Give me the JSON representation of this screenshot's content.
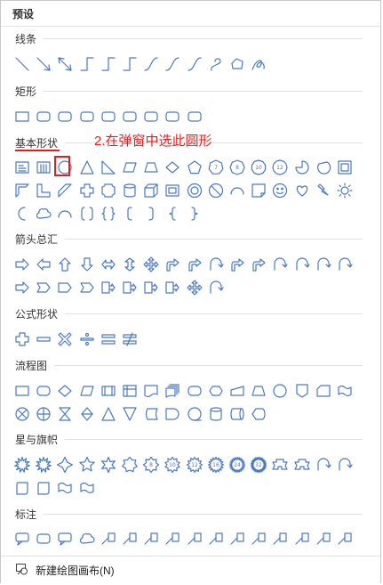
{
  "panel": {
    "title": "预设"
  },
  "sections": [
    {
      "label": "线条",
      "icons": [
        "line-icon",
        "arrow-line-icon",
        "double-arrow-line-icon",
        "elbow-connector-icon",
        "elbow-arrow-connector-icon",
        "elbow-double-arrow-connector-icon",
        "curved-connector-icon",
        "curved-arrow-connector-icon",
        "curved-double-arrow-connector-icon",
        "curve-icon",
        "freeform-icon",
        "scribble-icon"
      ]
    },
    {
      "label": "矩形",
      "icons": [
        "rectangle-icon",
        "rounded-rectangle-icon",
        "snip-single-corner-rectangle-icon",
        "snip-same-side-rectangle-icon",
        "snip-diagonal-rectangle-icon",
        "snip-round-rectangle-icon",
        "round-single-corner-rectangle-icon",
        "round-same-side-rectangle-icon",
        "round-diagonal-rectangle-icon"
      ]
    },
    {
      "label": "基本形状",
      "icons": [
        "text-box-icon",
        "vertical-text-box-icon",
        "oval-icon",
        "triangle-icon",
        "right-triangle-icon",
        "parallelogram-icon",
        "trapezoid-icon",
        "diamond-icon",
        "pentagon-icon",
        "heptagon-icon",
        "octagon-icon",
        "decagon-icon",
        "dodecagon-icon",
        "pie-icon",
        "chord-icon",
        "frame-icon",
        "half-frame-icon",
        "l-shape-icon",
        "diagonal-stripe-icon",
        "cross-icon",
        "plaque-icon",
        "can-icon",
        "cube-icon",
        "bevel-icon",
        "donut-icon",
        "no-symbol-icon",
        "block-arc-icon",
        "folded-corner-icon",
        "smiley-face-icon",
        "heart-icon",
        "lightning-bolt-icon",
        "sun-icon",
        "moon-icon",
        "cloud-icon",
        "arc-icon",
        "double-bracket-icon",
        "double-brace-icon",
        "left-bracket-icon",
        "right-bracket-icon",
        "left-brace-icon",
        "right-brace-icon"
      ]
    },
    {
      "label": "箭头总汇",
      "icons": [
        "right-arrow-icon",
        "left-arrow-icon",
        "up-arrow-icon",
        "down-arrow-icon",
        "left-right-arrow-icon",
        "up-down-arrow-icon",
        "quad-arrow-icon",
        "left-right-up-arrow-icon",
        "bent-arrow-icon",
        "u-turn-arrow-icon",
        "left-up-arrow-icon",
        "bent-up-arrow-icon",
        "curved-right-arrow-icon",
        "curved-left-arrow-icon",
        "curved-up-arrow-icon",
        "curved-down-arrow-icon",
        "striped-right-arrow-icon",
        "notched-right-arrow-icon",
        "pentagon-arrow-icon",
        "chevron-arrow-icon",
        "right-arrow-callout-icon",
        "left-arrow-callout-icon",
        "up-arrow-callout-icon",
        "down-arrow-callout-icon",
        "quad-arrow-callout-icon",
        "circular-arrow-icon"
      ]
    },
    {
      "label": "公式形状",
      "icons": [
        "plus-icon",
        "minus-icon",
        "multiply-icon",
        "divide-icon",
        "equal-icon",
        "not-equal-icon"
      ]
    },
    {
      "label": "流程图",
      "icons": [
        "process-icon",
        "alternate-process-icon",
        "decision-icon",
        "data-icon",
        "predefined-process-icon",
        "internal-storage-icon",
        "document-icon",
        "multidocument-icon",
        "terminator-icon",
        "preparation-icon",
        "manual-input-icon",
        "manual-operation-icon",
        "connector-icon",
        "off-page-connector-icon",
        "card-icon",
        "punched-tape-icon",
        "summing-junction-icon",
        "or-icon",
        "collate-icon",
        "sort-icon",
        "extract-icon",
        "merge-icon",
        "stored-data-icon",
        "delay-icon",
        "sequential-access-storage-icon",
        "magnetic-disk-icon",
        "direct-access-storage-icon",
        "display-icon"
      ]
    },
    {
      "label": "星与旗帜",
      "icons": [
        "explosion-1-icon",
        "explosion-2-icon",
        "star-4-point-icon",
        "star-5-point-icon",
        "star-6-point-icon",
        "star-7-point-icon",
        "star-8-point-icon",
        "star-10-point-icon",
        "star-12-point-icon",
        "star-16-point-icon",
        "star-24-point-icon",
        "star-32-point-icon",
        "up-ribbon-icon",
        "down-ribbon-icon",
        "curved-up-ribbon-icon",
        "curved-down-ribbon-icon",
        "vertical-scroll-icon",
        "horizontal-scroll-icon",
        "wave-icon",
        "double-wave-icon"
      ]
    },
    {
      "label": "标注",
      "icons": [
        "rectangular-callout-icon",
        "rounded-rectangular-callout-icon",
        "oval-callout-icon",
        "cloud-callout-icon",
        "line-callout-1-icon",
        "line-callout-2-icon",
        "line-callout-3-icon",
        "line-callout-4-icon",
        "line-callout-1-accent-bar-icon",
        "line-callout-2-accent-bar-icon",
        "line-callout-3-accent-bar-icon",
        "line-callout-4-accent-bar-icon",
        "line-callout-1-no-border-icon",
        "line-callout-2-no-border-icon",
        "line-callout-3-no-border-icon",
        "line-callout-4-no-border-icon"
      ]
    }
  ],
  "polygon_labels": [
    "7",
    "8",
    "10",
    "12"
  ],
  "star_labels": [
    "8",
    "10",
    "12",
    "16",
    "24",
    "32"
  ],
  "annotation": "2.在弹窗中选此圆形",
  "footer": {
    "label": "新建绘图画布(N)"
  },
  "colors": {
    "icon": "#4a79c2",
    "highlight": "#e02020",
    "text": "#333333"
  }
}
